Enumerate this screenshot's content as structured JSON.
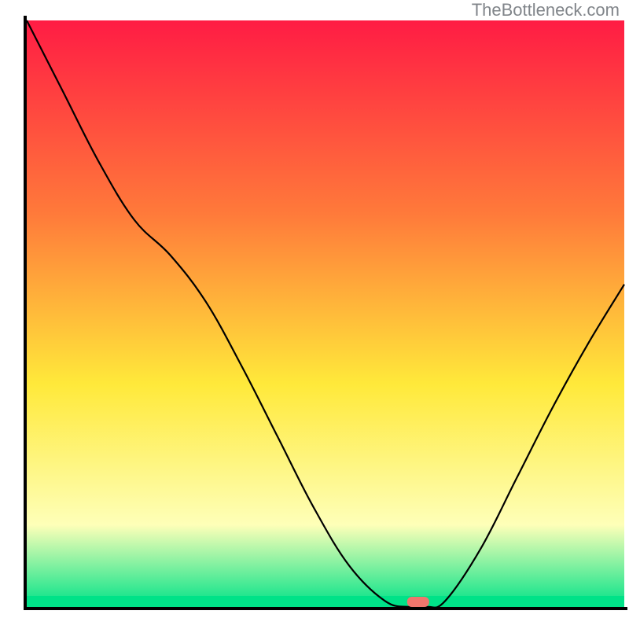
{
  "watermark_text": "TheBottleneck.com",
  "chart_data": {
    "type": "line",
    "title": "",
    "xlabel": "",
    "ylabel": "",
    "x": [
      0.0,
      0.06,
      0.12,
      0.18,
      0.24,
      0.3,
      0.36,
      0.42,
      0.48,
      0.54,
      0.6,
      0.64,
      0.67,
      0.7,
      0.76,
      0.82,
      0.88,
      0.94,
      1.0
    ],
    "values": [
      1.0,
      0.88,
      0.76,
      0.66,
      0.6,
      0.52,
      0.41,
      0.29,
      0.17,
      0.07,
      0.01,
      0.0,
      0.0,
      0.01,
      0.1,
      0.22,
      0.34,
      0.45,
      0.55
    ],
    "xlim": [
      0,
      1
    ],
    "ylim": [
      0,
      1
    ],
    "background_gradient": {
      "top": "#ff1c44",
      "mid_top": "#ff7a3a",
      "mid": "#ffe93a",
      "mid_bottom": "#feffb8",
      "bottom": "#00e288"
    },
    "marker": {
      "x_frac": 0.655,
      "color": "#f0766d"
    },
    "axis_color": "#000000",
    "curve_color": "#000000"
  }
}
